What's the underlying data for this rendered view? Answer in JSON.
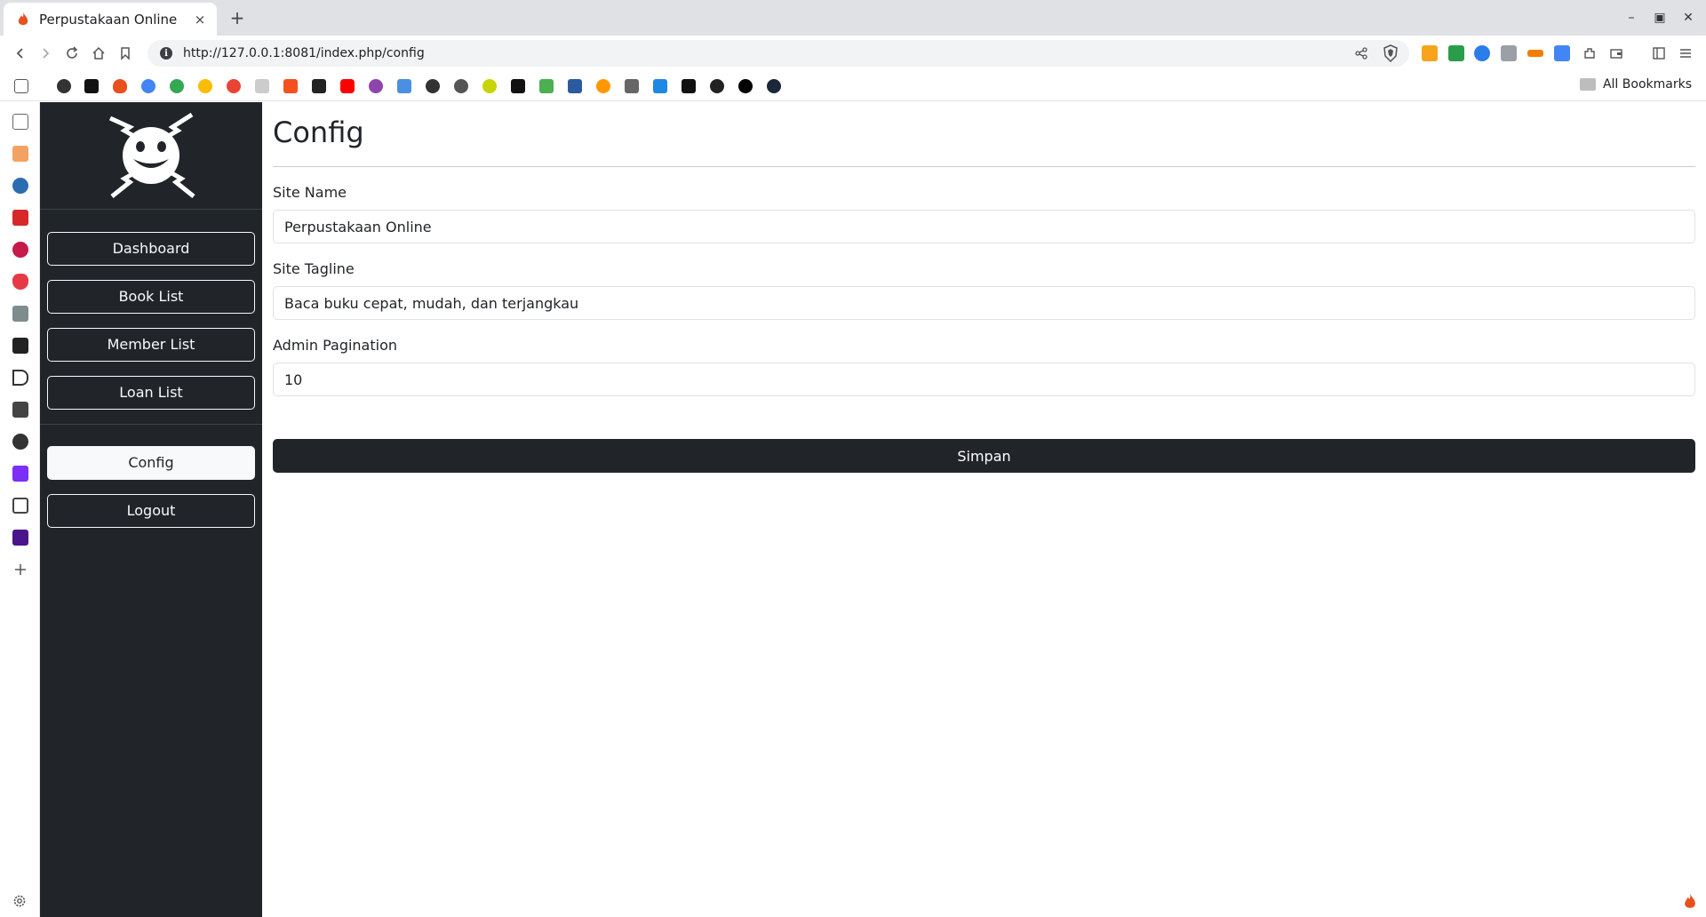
{
  "browser": {
    "tab_title": "Perpustakaan Online",
    "tab_close": "×",
    "new_tab": "+",
    "url": "http://127.0.0.1:8081/index.php/config",
    "all_bookmarks": "All Bookmarks",
    "window_controls": {
      "minimize": "–",
      "maximize": "▣",
      "close": "✕"
    },
    "icons": [
      "back-icon",
      "forward-icon",
      "reload-icon",
      "home-icon",
      "bookmark-icon",
      "site-info-icon",
      "share-icon",
      "brave-shield-icon",
      "extensions-icon",
      "sidebar-icon",
      "menu-icon"
    ]
  },
  "sidebar": {
    "items": [
      {
        "name": "nav-dashboard",
        "label": "Dashboard",
        "active": false
      },
      {
        "name": "nav-book-list",
        "label": "Book List",
        "active": false
      },
      {
        "name": "nav-member-list",
        "label": "Member List",
        "active": false
      },
      {
        "name": "nav-loan-list",
        "label": "Loan List",
        "active": false
      }
    ],
    "bottom_items": [
      {
        "name": "nav-config",
        "label": "Config",
        "active": true
      },
      {
        "name": "nav-logout",
        "label": "Logout",
        "active": false
      }
    ]
  },
  "page": {
    "title": "Config",
    "fields": {
      "site_name_label": "Site Name",
      "site_name_value": "Perpustakaan Online",
      "site_tagline_label": "Site Tagline",
      "site_tagline_value": "Baca buku cepat, mudah, dan terjangkau",
      "admin_pagination_label": "Admin Pagination",
      "admin_pagination_value": "10"
    },
    "submit_label": "Simpan"
  },
  "colors": {
    "sidebar_bg": "#212529",
    "button_dark": "#212529",
    "text_light": "#f8f9fa",
    "accent_flame": "#e8501e"
  }
}
